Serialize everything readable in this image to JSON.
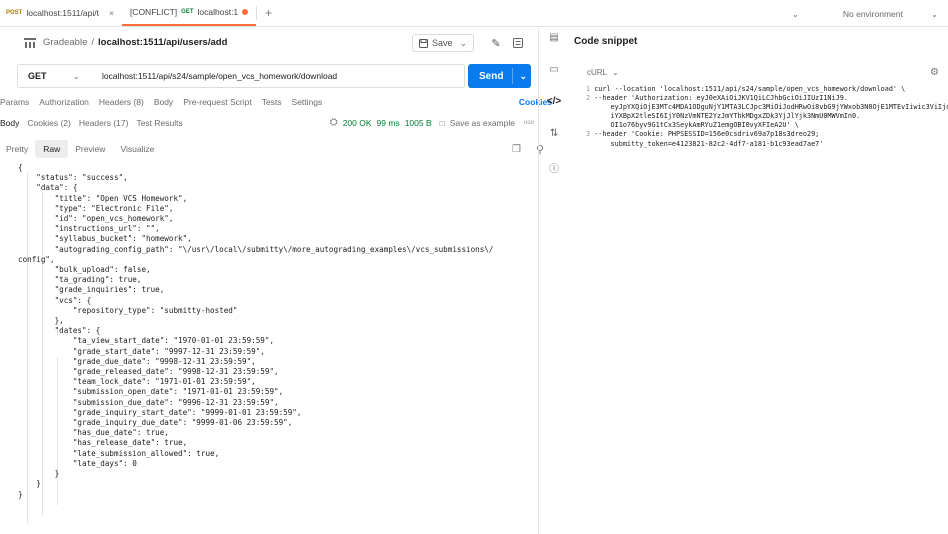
{
  "tabs": [
    {
      "method": "POST",
      "label": "localhost:1511/api/t",
      "close": "×"
    },
    {
      "method": "GET",
      "prefix": "[CONFLICT]",
      "label": "localhost:1"
    }
  ],
  "add_tab": "+",
  "environment": "No environment",
  "breadcrumb": {
    "workspace": "Gradeable",
    "separator": "/",
    "current": "localhost:1511/api/users/add"
  },
  "save_label": "Save",
  "request": {
    "method": "GET",
    "url": "localhost:1511/api/s24/sample/open_vcs_homework/download",
    "send_label": "Send"
  },
  "request_tabs": [
    "Params",
    "Authorization",
    "Headers (8)",
    "Body",
    "Pre-request Script",
    "Tests",
    "Settings"
  ],
  "cookies_link": "Cookies",
  "response_tabs": [
    "Body",
    "Cookies (2)",
    "Headers (17)",
    "Test Results"
  ],
  "response_status": {
    "code": "200 OK",
    "time": "99 ms",
    "size": "1005 B",
    "save_example": "Save as example",
    "more": "ooo"
  },
  "view_tabs": [
    "Pretty",
    "Raw",
    "Preview",
    "Visualize"
  ],
  "response_body": "{\n    \"status\": \"success\",\n    \"data\": {\n        \"title\": \"Open VCS Homework\",\n        \"type\": \"Electronic File\",\n        \"id\": \"open_vcs_homework\",\n        \"instructions_url\": \"\",\n        \"syllabus_bucket\": \"homework\",\n        \"autograding_config_path\": \"\\/usr\\/local\\/submitty\\/more_autograding_examples\\/vcs_submissions\\/\nconfig\",\n        \"bulk_upload\": false,\n        \"ta_grading\": true,\n        \"grade_inquiries\": true,\n        \"vcs\": {\n            \"repository_type\": \"submitty-hosted\"\n        },\n        \"dates\": {\n            \"ta_view_start_date\": \"1970-01-01 23:59:59\",\n            \"grade_start_date\": \"9997-12-31 23:59:59\",\n            \"grade_due_date\": \"9998-12-31 23:59:59\",\n            \"grade_released_date\": \"9998-12-31 23:59:59\",\n            \"team_lock_date\": \"1971-01-01 23:59:59\",\n            \"submission_open_date\": \"1971-01-01 23:59:59\",\n            \"submission_due_date\": \"9996-12-31 23:59:59\",\n            \"grade_inquiry_start_date\": \"9999-01-01 23:59:59\",\n            \"grade_inquiry_due_date\": \"9999-01-06 23:59:59\",\n            \"has_due_date\": true,\n            \"has_release_date\": true,\n            \"late_submission_allowed\": true,\n            \"late_days\": 0\n        }\n    }\n}",
  "snippet": {
    "title": "Code snippet",
    "language": "cURL",
    "lines": [
      {
        "n": "1",
        "text": "curl --location 'localhost:1511/api/s24/sample/open_vcs_homework/download' \\"
      },
      {
        "n": "2",
        "text": "--header 'Authorization: eyJ0eXAiOiJKV1QiLCJhbGciOiJIUzI1NiJ9."
      },
      {
        "n": "",
        "text": "    eyJpYXQiOjE3MTc4MDA1ODguNjY1MTA3LCJpc3MiOiJodHRwOi8vbG9jYWxob3N0OjE1MTEvIiwic3ViIjoid..."
      },
      {
        "n": "",
        "text": "    iYXBpX2tleSI6IjY0NzVmNTE2YzJmYThkMDgxZDk3YjJlYjk3NmU0MWVmIn0."
      },
      {
        "n": "",
        "text": "    OI1o76byv9G1tCx3SeykAmRYuZ1emgOBI0vyXFIeA2U' \\"
      },
      {
        "n": "3",
        "text": "--header 'Cookie: PHPSESSID=156e0csdriv69a7p18s3dreo29;"
      },
      {
        "n": "",
        "text": "    submitty_token=e4123821-82c2-4df7-a181-b1c93ead7ae7'"
      }
    ]
  },
  "colors": {
    "accent": "#ff6c37",
    "send": "#097bed",
    "status_ok": "#007f31"
  }
}
